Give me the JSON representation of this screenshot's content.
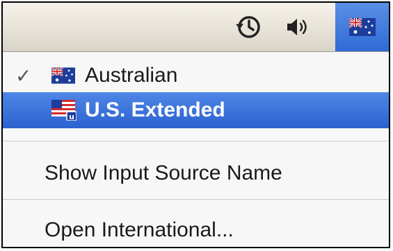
{
  "menubar": {
    "icons": [
      "time-machine-icon",
      "volume-icon",
      "australia-flag-icon"
    ]
  },
  "menu": {
    "items": [
      {
        "label": "Australian",
        "checked": true,
        "flag": "australia"
      },
      {
        "label": "U.S. Extended",
        "checked": false,
        "flag": "usa",
        "highlighted": true
      }
    ],
    "show_name": "Show Input Source Name",
    "open_international": "Open International..."
  },
  "colors": {
    "highlight": "#2f6bd4",
    "menubar": "#e6e1d6",
    "menu_bg": "#f7f7f7"
  }
}
